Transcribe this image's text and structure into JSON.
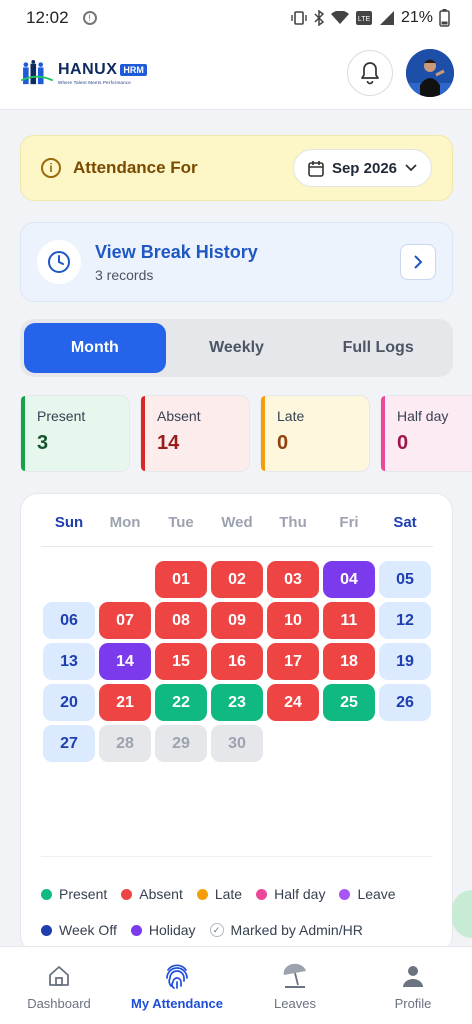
{
  "status_bar": {
    "time": "12:02",
    "battery": "21%"
  },
  "header": {
    "logo": {
      "name": "HANUX",
      "badge": "HRM",
      "tagline": "Where Talent Meets Performance"
    }
  },
  "attendance_for": {
    "label": "Attendance For",
    "selected_month": "Sep 2026"
  },
  "break_history": {
    "title": "View Break History",
    "subtitle": "3 records"
  },
  "tabs": [
    {
      "label": "Month",
      "active": true
    },
    {
      "label": "Weekly",
      "active": false
    },
    {
      "label": "Full Logs",
      "active": false
    }
  ],
  "stats": [
    {
      "label": "Present",
      "value": "3",
      "color": "#16a34a",
      "bg": "#e8f7ee",
      "text": "#14532d"
    },
    {
      "label": "Absent",
      "value": "14",
      "color": "#dc2626",
      "bg": "#fdecec",
      "text": "#991b1b"
    },
    {
      "label": "Late",
      "value": "0",
      "color": "#f59e0b",
      "bg": "#fdf7dd",
      "text": "#92400e"
    },
    {
      "label": "Half day",
      "value": "0",
      "color": "#ec4899",
      "bg": "#fdebf3",
      "text": "#9d174d"
    }
  ],
  "calendar": {
    "weekdays": [
      "Sun",
      "Mon",
      "Tue",
      "Wed",
      "Thu",
      "Fri",
      "Sat"
    ],
    "weeks": [
      [
        null,
        null,
        {
          "d": "01",
          "s": "absent"
        },
        {
          "d": "02",
          "s": "absent"
        },
        {
          "d": "03",
          "s": "absent"
        },
        {
          "d": "04",
          "s": "holiday"
        },
        {
          "d": "05",
          "s": "weekoff"
        }
      ],
      [
        {
          "d": "06",
          "s": "weekoff"
        },
        {
          "d": "07",
          "s": "absent"
        },
        {
          "d": "08",
          "s": "absent"
        },
        {
          "d": "09",
          "s": "absent"
        },
        {
          "d": "10",
          "s": "absent"
        },
        {
          "d": "11",
          "s": "absent"
        },
        {
          "d": "12",
          "s": "weekoff"
        }
      ],
      [
        {
          "d": "13",
          "s": "weekoff"
        },
        {
          "d": "14",
          "s": "holiday"
        },
        {
          "d": "15",
          "s": "absent"
        },
        {
          "d": "16",
          "s": "absent"
        },
        {
          "d": "17",
          "s": "absent"
        },
        {
          "d": "18",
          "s": "absent"
        },
        {
          "d": "19",
          "s": "weekoff"
        }
      ],
      [
        {
          "d": "20",
          "s": "weekoff"
        },
        {
          "d": "21",
          "s": "absent"
        },
        {
          "d": "22",
          "s": "present"
        },
        {
          "d": "23",
          "s": "present"
        },
        {
          "d": "24",
          "s": "absent"
        },
        {
          "d": "25",
          "s": "present"
        },
        {
          "d": "26",
          "s": "weekoff"
        }
      ],
      [
        {
          "d": "27",
          "s": "weekoff"
        },
        {
          "d": "28",
          "s": "future"
        },
        {
          "d": "29",
          "s": "future"
        },
        {
          "d": "30",
          "s": "future"
        },
        null,
        null,
        null
      ]
    ],
    "status_colors": {
      "absent": {
        "bg": "#ef4444",
        "fg": "#ffffff"
      },
      "present": {
        "bg": "#10b981",
        "fg": "#ffffff"
      },
      "holiday": {
        "bg": "#7c3aed",
        "fg": "#ffffff"
      },
      "weekoff": {
        "bg": "#dbeafe",
        "fg": "#1e40af"
      },
      "future": {
        "bg": "#e5e7eb",
        "fg": "#9ca3af"
      }
    }
  },
  "legend": [
    [
      {
        "label": "Present",
        "color": "#10b981"
      },
      {
        "label": "Absent",
        "color": "#ef4444"
      },
      {
        "label": "Late",
        "color": "#f59e0b"
      },
      {
        "label": "Half day",
        "color": "#ec4899"
      },
      {
        "label": "Leave",
        "color": "#a855f7"
      }
    ],
    [
      {
        "label": "Week Off",
        "color": "#1e40af"
      },
      {
        "label": "Holiday",
        "color": "#7c3aed"
      },
      {
        "label": "Marked by Admin/HR",
        "color": null
      }
    ]
  ],
  "bottom_nav": [
    {
      "label": "Dashboard",
      "icon": "home-icon",
      "active": false
    },
    {
      "label": "My Attendance",
      "icon": "fingerprint-icon",
      "active": true
    },
    {
      "label": "Leaves",
      "icon": "beach-umbrella-icon",
      "active": false
    },
    {
      "label": "Profile",
      "icon": "person-icon",
      "active": false
    }
  ]
}
